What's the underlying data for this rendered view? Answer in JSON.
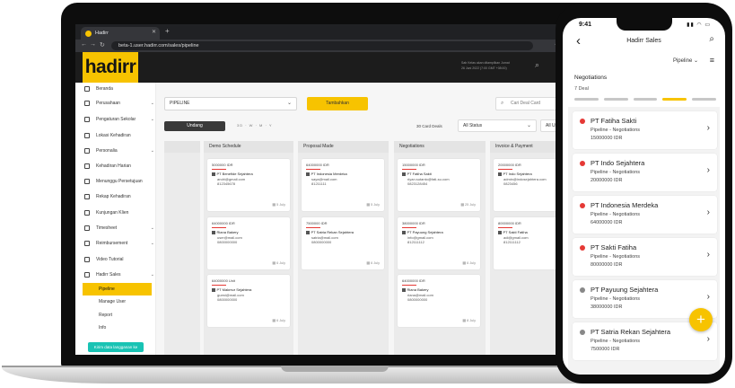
{
  "browser": {
    "tab_title": "Hadirr",
    "url": "beta-1.user.hadirr.com/sales/pipeline"
  },
  "app": {
    "logo_text": "hadirr",
    "header_info_line1": "Sab Kelas akan ditampilkan Jumat",
    "header_info_line2": "26 Juni 2022 (7:00 GMT +08:00)"
  },
  "sidebar": {
    "items": [
      {
        "label": "Beranda",
        "chevron": false
      },
      {
        "label": "Perusahaan",
        "chevron": true
      },
      {
        "label": "Pengaturan Sekolar",
        "chevron": true
      },
      {
        "label": "Lokasi Kehadiran",
        "chevron": false
      },
      {
        "label": "Personalia",
        "chevron": true
      },
      {
        "label": "Kehadiran Harian",
        "chevron": false
      },
      {
        "label": "Menunggu Persetujuan",
        "chevron": false
      },
      {
        "label": "Rekap Kehadiran",
        "chevron": false
      },
      {
        "label": "Kunjungan Klien",
        "chevron": false
      },
      {
        "label": "Timesheet",
        "chevron": true
      },
      {
        "label": "Reimbursement",
        "chevron": true
      },
      {
        "label": "Video Tutorial",
        "chevron": false
      },
      {
        "label": "Hadirr Sales",
        "chevron": true
      }
    ],
    "subitems": [
      "Pipeline",
      "Manage User",
      "Report",
      "Info"
    ],
    "bottom_button": "Kirim data langganan ke"
  },
  "main": {
    "pipeline_select": "PIPELINE",
    "add_button": "Tambahkan",
    "search_placeholder": "Cari Deal Card",
    "invite_button": "Undang",
    "view_toggle": "3D · W · M · Y",
    "deal_count": "30 Card Deals",
    "status_filter": "All Status",
    "user_filter": "All User",
    "columns": [
      {
        "title": "Demo Schedule",
        "cards": [
          {
            "amount": "5000000 IDR",
            "company": "PT Benefide Sejahtera",
            "email": "andri@gmail.com",
            "phone": "812345678",
            "days": "5 July"
          },
          {
            "amount": "64000000 IDR",
            "company": "Riana Bakery",
            "email": "user@mail.com",
            "phone": "0800000000",
            "days": "6 July"
          },
          {
            "amount": "64000000 Unit",
            "company": "PT Makmur Sejahtera",
            "email": "guest@mail.com",
            "phone": "0800000000",
            "days": "6 July"
          }
        ]
      },
      {
        "title": "Proposal Made",
        "cards": [
          {
            "amount": "64000000 IDR",
            "company": "PT Indonesia Merdeka",
            "email": "saya@mail.com",
            "phone": "81211111",
            "days": "5 July"
          },
          {
            "amount": "7500000 IDR",
            "company": "PT Satria Rekan Sejahtera",
            "email": "satria@mail.com",
            "phone": "0800000000",
            "days": "6 July"
          }
        ]
      },
      {
        "title": "Negotiations",
        "cards": [
          {
            "amount": "15000000 IDR",
            "company": "PT Fatiha Sakti",
            "email": "riyan.sutanto@fati-su.com",
            "phone": "0823128454",
            "days": "25 July"
          },
          {
            "amount": "38000000 IDR",
            "company": "PT Payuung Sejahtera",
            "email": "info@gmail.com",
            "phone": "812111112",
            "days": "6 July"
          },
          {
            "amount": "64000000 IDR",
            "company": "Riana Bakery",
            "email": "riana@mail.com",
            "phone": "0800000000",
            "days": "8 July"
          }
        ]
      },
      {
        "title": "Invoice & Payment",
        "cards": [
          {
            "amount": "20000000 IDR",
            "company": "PT Indo Sejahtera",
            "email": "admin@indosejahtera.com",
            "phone": "0823456",
            "days": "5 July"
          },
          {
            "amount": "80000000 IDR",
            "company": "PT Sakti Fatiha",
            "email": "adi@gmail.com",
            "phone": "812111112",
            "days": "6 July"
          }
        ]
      }
    ]
  },
  "phone": {
    "time": "9:41",
    "title": "Hadirr Sales",
    "pipeline_label": "Pipeline",
    "section_title": "Negotiations",
    "section_sub": "7 Deal",
    "stages_active_index": 3,
    "stage_count": 5,
    "deals": [
      {
        "name": "PT Fatiha Sakti",
        "stage": "Pipeline - Negotiations",
        "amount": "15000000 IDR",
        "color": "#e53935"
      },
      {
        "name": "PT Indo Sejahtera",
        "stage": "Pipeline - Negotiations",
        "amount": "20000000 IDR",
        "color": "#e53935"
      },
      {
        "name": "PT Indonesia Merdeka",
        "stage": "Pipeline - Negotiations",
        "amount": "64000000 IDR",
        "color": "#e53935"
      },
      {
        "name": "PT Sakti Fatiha",
        "stage": "Pipeline - Negotiations",
        "amount": "80000000 IDR",
        "color": "#e53935"
      },
      {
        "name": "PT Payuung Sejahtera",
        "stage": "Pipeline - Negotiations",
        "amount": "38000000 IDR",
        "color": "#888888"
      },
      {
        "name": "PT Satria Rekan Sejahtera",
        "stage": "Pipeline - Negotiations",
        "amount": "7500000 IDR",
        "color": "#888888"
      }
    ]
  }
}
